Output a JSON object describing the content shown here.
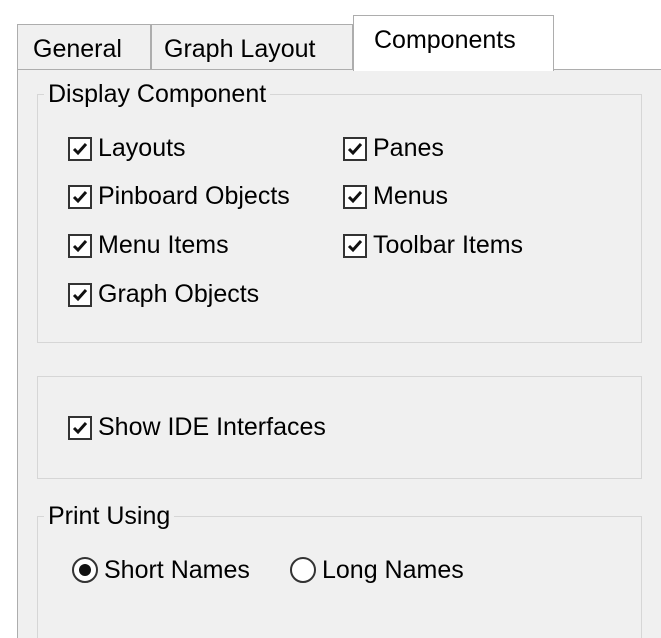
{
  "tabs": [
    {
      "label": "General",
      "active": false
    },
    {
      "label": "Graph Layout",
      "active": false
    },
    {
      "label": "Components",
      "active": true
    }
  ],
  "display_component": {
    "title": "Display Component",
    "items": [
      {
        "label": "Layouts",
        "checked": true
      },
      {
        "label": "Panes",
        "checked": true
      },
      {
        "label": "Pinboard Objects",
        "checked": true
      },
      {
        "label": "Menus",
        "checked": true
      },
      {
        "label": "Menu Items",
        "checked": true
      },
      {
        "label": "Toolbar Items",
        "checked": true
      },
      {
        "label": "Graph Objects",
        "checked": true
      }
    ]
  },
  "ide": {
    "show_ide_interfaces": {
      "label": "Show IDE Interfaces",
      "checked": true
    }
  },
  "print_using": {
    "title": "Print Using",
    "options": [
      {
        "label": "Short Names",
        "selected": true
      },
      {
        "label": "Long Names",
        "selected": false
      }
    ]
  }
}
